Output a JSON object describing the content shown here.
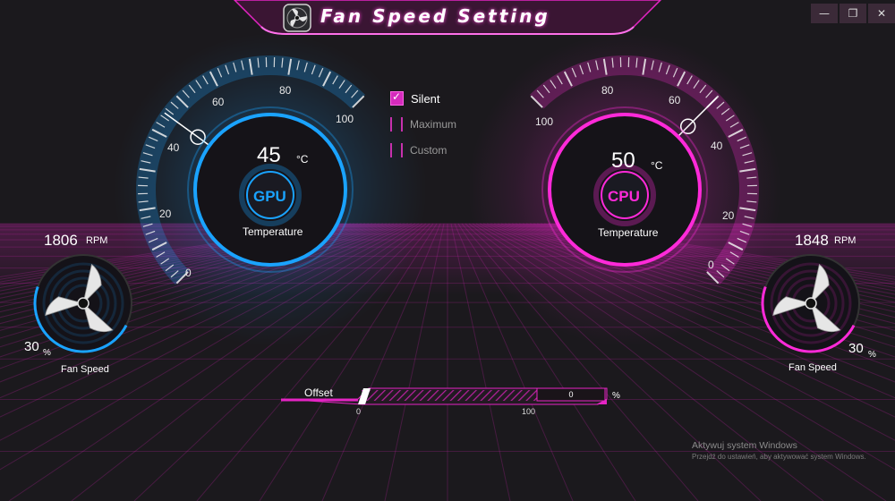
{
  "window": {
    "title": "Fan Speed Setting",
    "controls": [
      "—",
      "❐",
      "✕"
    ]
  },
  "gpu": {
    "chip": "GPU",
    "temp": "45",
    "unit": "°C",
    "label": "Temperature",
    "scale": [
      "0",
      "20",
      "40",
      "60",
      "80",
      "100"
    ],
    "temp_value": 45,
    "color": "#1aa3ff"
  },
  "cpu": {
    "chip": "CPU",
    "temp": "50",
    "unit": "°C",
    "label": "Temperature",
    "scale": [
      "0",
      "20",
      "40",
      "60",
      "80",
      "100"
    ],
    "temp_value": 50,
    "color": "#ff2ad9"
  },
  "left_fan": {
    "rpm": "1806",
    "rpm_unit": "RPM",
    "percent": "30",
    "percent_unit": "%",
    "label": "Fan Speed",
    "fraction": 0.3
  },
  "right_fan": {
    "rpm": "1848",
    "rpm_unit": "RPM",
    "percent": "30",
    "percent_unit": "%",
    "label": "Fan Speed",
    "fraction": 0.3
  },
  "modes": [
    {
      "label": "Silent",
      "checked": true
    },
    {
      "label": "Maximum",
      "checked": false
    },
    {
      "label": "Custom",
      "checked": false
    }
  ],
  "offset": {
    "label": "Offset",
    "min": "0",
    "max": "100",
    "value": "0",
    "unit": "%"
  },
  "watermark": {
    "line1": "Aktywuj system Windows",
    "line2": "Przejdź do ustawień, aby aktywować system Windows."
  },
  "colors": {
    "accent": "#e524c4",
    "gpu": "#1aa3ff",
    "background": "#1b191d"
  },
  "icons": {
    "logo": "fan-icon",
    "fan": "fan-blade-icon",
    "minimize": "minimize-icon",
    "restore": "restore-icon",
    "close": "close-icon"
  }
}
